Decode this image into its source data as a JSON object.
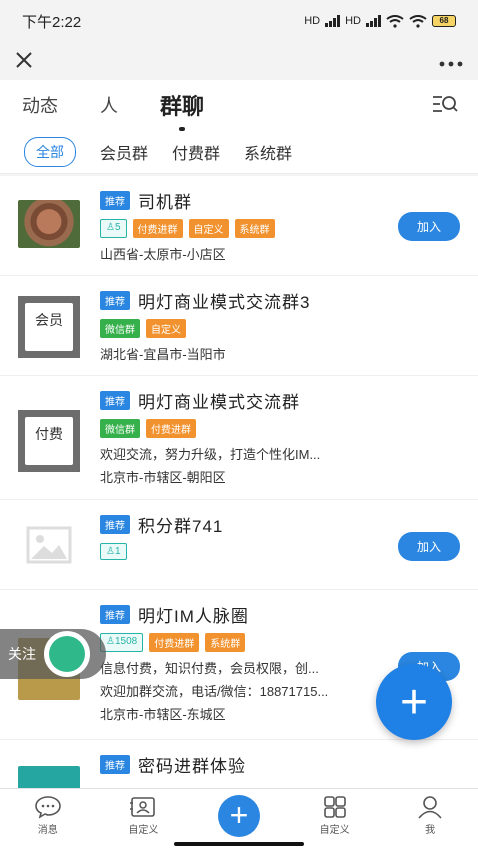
{
  "status_bar": {
    "time": "下午2:22",
    "net1": "HD",
    "net2": "HD",
    "battery": "68"
  },
  "top_tabs": [
    {
      "label": "动态"
    },
    {
      "label": "人"
    },
    {
      "label": "群聊"
    }
  ],
  "sub_tabs": [
    {
      "label": "全部"
    },
    {
      "label": "会员群"
    },
    {
      "label": "付费群"
    },
    {
      "label": "系统群"
    }
  ],
  "groups": [
    {
      "badge": "推荐",
      "name": "司机群",
      "tags": [
        "5",
        "付费进群",
        "自定义",
        "系统群"
      ],
      "location": "山西省-太原市-小店区",
      "join": "加入"
    },
    {
      "badge": "推荐",
      "name": "明灯商业模式交流群3",
      "avatar_text": "会员",
      "tags": [
        "微信群",
        "自定义"
      ],
      "location": "湖北省-宜昌市-当阳市"
    },
    {
      "badge": "推荐",
      "name": "明灯商业模式交流群",
      "avatar_text": "付费",
      "tags": [
        "微信群",
        "付费进群"
      ],
      "desc": "欢迎交流，努力升级，打造个性化IM...",
      "location": "北京市-市辖区-朝阳区"
    },
    {
      "badge": "推荐",
      "name": "积分群741",
      "tags": [
        "1"
      ],
      "join": "加入"
    },
    {
      "badge": "推荐",
      "name": "明灯IM人脉圈",
      "tags": [
        "1508",
        "付费进群",
        "系统群"
      ],
      "desc": "信息付费，知识付费，会员权限，创...",
      "desc2": "欢迎加群交流，电话/微信：18871715...",
      "location": "北京市-市辖区-东城区",
      "join": "加入"
    },
    {
      "badge": "推荐",
      "name": "密码进群体验"
    }
  ],
  "follow": {
    "label": "关注"
  },
  "fab": {
    "symbol": "+"
  },
  "bottom_nav": [
    {
      "label": "消息",
      "icon": "chat-icon"
    },
    {
      "label": "自定义",
      "icon": "contact-card-icon"
    },
    {
      "label": "",
      "icon": "plus-icon"
    },
    {
      "label": "自定义",
      "icon": "grid-icon"
    },
    {
      "label": "我",
      "icon": "user-icon"
    }
  ],
  "colors": {
    "accent": "#2a86e0",
    "orange_tag": "#f2922f",
    "green_tag": "#35b04a",
    "teal_tag": "#26b4a8"
  }
}
